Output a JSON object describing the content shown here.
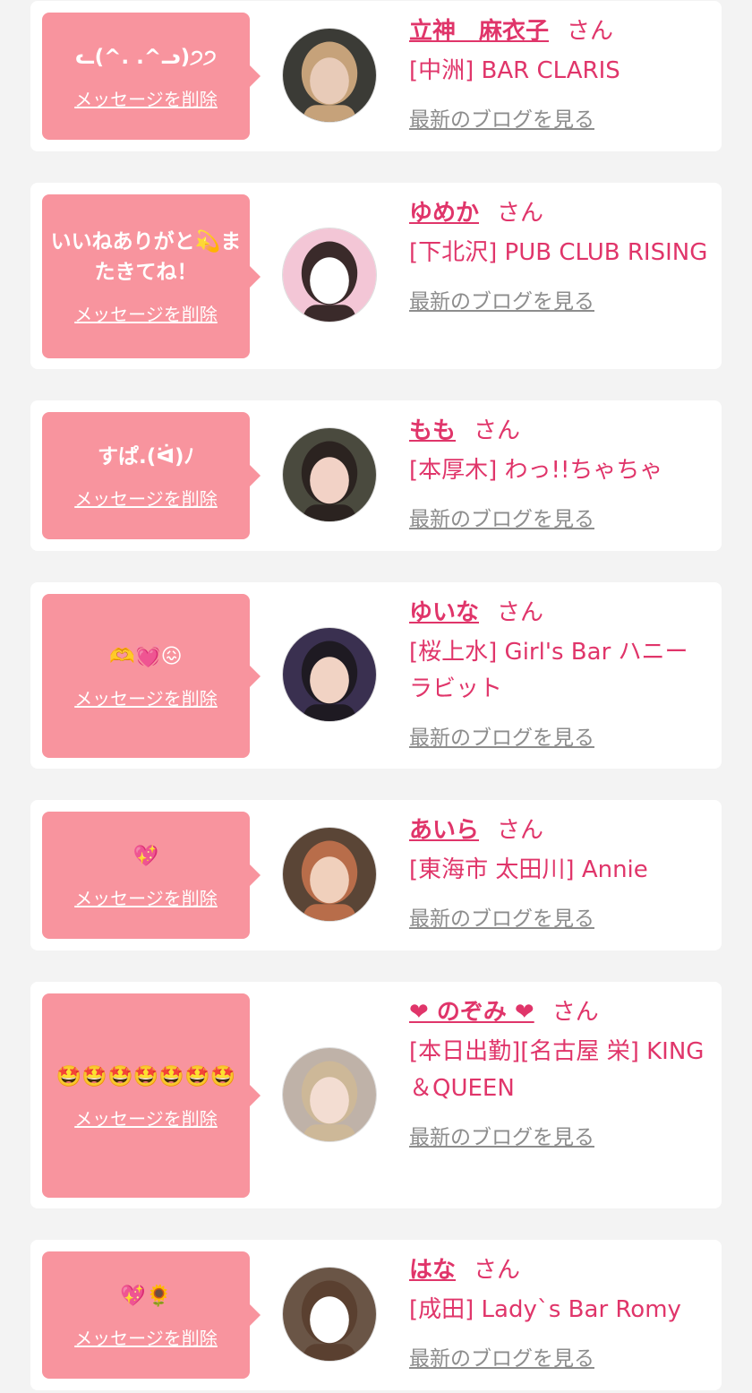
{
  "messages": [
    {
      "message": "ᓚ(^. .^ᓗ)੭੭",
      "delete_label": "メッセージを削除",
      "name": "立神　麻衣子",
      "honorific": "さん",
      "shop": "[中洲] BAR CLARIS",
      "blog_link": "最新のブログを見る",
      "avatar_colors": {
        "bg": "#3b3b36",
        "face": "#e8cbb8",
        "hair": "#c6a27a"
      }
    },
    {
      "message": "いいねありがと💫またきてね！",
      "delete_label": "メッセージを削除",
      "name": "ゆめか",
      "honorific": "さん",
      "shop": "[下北沢] PUB CLUB RISING",
      "blog_link": "最新のブログを見る",
      "avatar_colors": {
        "bg": "#f3c6d6",
        "face": "#ffffff",
        "hair": "#3a2a2a"
      }
    },
    {
      "message": "すぱ.(ᐛ)ﾉ",
      "delete_label": "メッセージを削除",
      "name": "もも",
      "honorific": "さん",
      "shop": "[本厚木] わっ!!ちゃちゃ",
      "blog_link": "最新のブログを見る",
      "avatar_colors": {
        "bg": "#4a4a3e",
        "face": "#f2d2c6",
        "hair": "#2b2320"
      }
    },
    {
      "message": "🫶💓😖",
      "delete_label": "メッセージを削除",
      "name": "ゆいな",
      "honorific": "さん",
      "shop": "[桜上水] Girl's Bar ハニーラビット",
      "blog_link": "最新のブログを見る",
      "avatar_colors": {
        "bg": "#3a3050",
        "face": "#f1d3c4",
        "hair": "#1e1a22"
      }
    },
    {
      "message": "💖",
      "delete_label": "メッセージを削除",
      "name": "あいら",
      "honorific": "さん",
      "shop": "[東海市 太田川] Annie",
      "blog_link": "最新のブログを見る",
      "avatar_colors": {
        "bg": "#5a4536",
        "face": "#f0d0bc",
        "hair": "#b86d4a"
      }
    },
    {
      "message": "🤩🤩🤩🤩🤩🤩🤩",
      "delete_label": "メッセージを削除",
      "name": "❤ のぞみ ❤",
      "honorific": "さん",
      "shop": "[本日出勤][名古屋 栄] KING＆QUEEN",
      "blog_link": "最新のブログを見る",
      "avatar_colors": {
        "bg": "#bfb2a8",
        "face": "#f3ddd2",
        "hair": "#cdb898"
      }
    },
    {
      "message": "💖🌻",
      "delete_label": "メッセージを削除",
      "name": "はな",
      "honorific": "さん",
      "shop": "[成田] Lady`s Bar Romy",
      "blog_link": "最新のブログを見る",
      "avatar_colors": {
        "bg": "#6a5546",
        "face": "#ffffff",
        "hair": "#5a4030"
      }
    }
  ]
}
